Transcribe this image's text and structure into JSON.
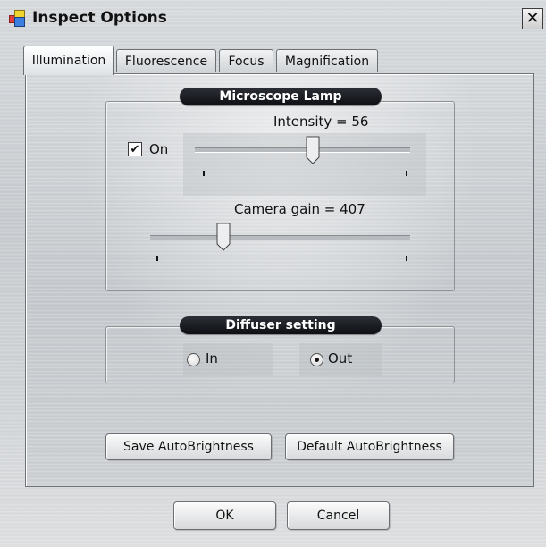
{
  "window": {
    "title": "Inspect Options",
    "close_label": "✕"
  },
  "tabs": [
    {
      "label": "Illumination",
      "active": true
    },
    {
      "label": "Fluorescence",
      "active": false
    },
    {
      "label": "Focus",
      "active": false
    },
    {
      "label": "Magnification",
      "active": false
    }
  ],
  "lamp": {
    "title": "Microscope Lamp",
    "on_label": "On",
    "on_checked": true,
    "intensity_label": "Intensity = 56",
    "intensity_value": 56,
    "camera_gain_label": "Camera gain = 407",
    "camera_gain_value": 407
  },
  "diffuser": {
    "title": "Diffuser setting",
    "options": [
      {
        "label": "In",
        "selected": false
      },
      {
        "label": "Out",
        "selected": true
      }
    ]
  },
  "buttons": {
    "save_auto": "Save AutoBrightness",
    "default_auto": "Default AutoBrightness",
    "ok": "OK",
    "cancel": "Cancel"
  },
  "icons": {
    "app": "app-icon",
    "checkbox_mark": "✔"
  }
}
